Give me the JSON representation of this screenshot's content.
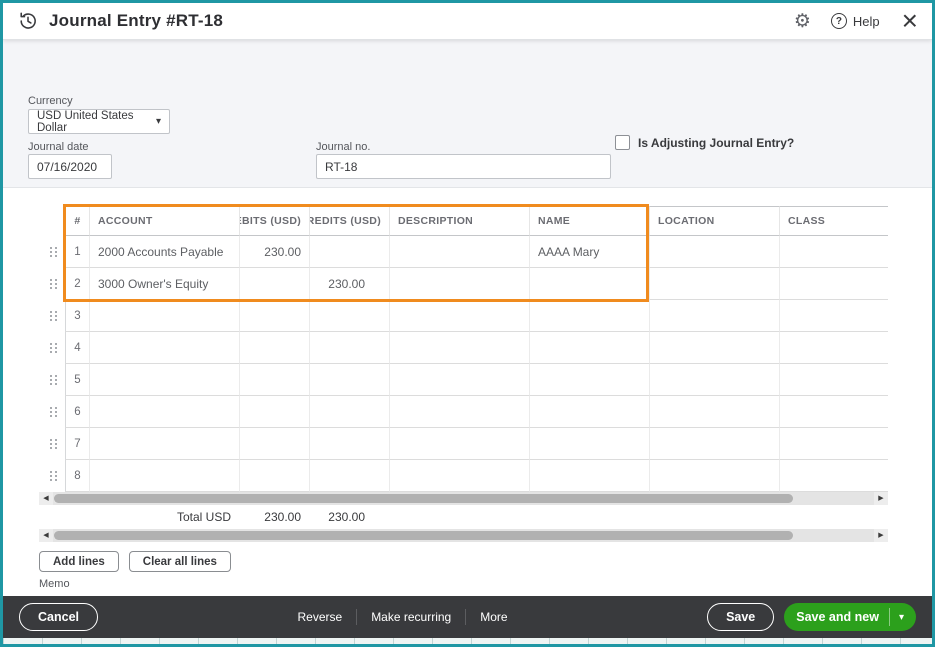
{
  "colors": {
    "teal": "#1f97a4",
    "orange": "#f08b1e",
    "green": "#2ca01c",
    "footer": "#393a3d"
  },
  "header": {
    "title": "Journal Entry #RT-18",
    "help_label": "Help"
  },
  "form": {
    "currency_label": "Currency",
    "currency_value": "USD United States Dollar",
    "journal_date_label": "Journal date",
    "journal_date_value": "07/16/2020",
    "journal_no_label": "Journal no.",
    "journal_no_value": "RT-18",
    "adjusting_label": "Is Adjusting Journal Entry?"
  },
  "table": {
    "columns": [
      "#",
      "ACCOUNT",
      "DEBITS (USD)",
      "CREDITS (USD)",
      "DESCRIPTION",
      "NAME",
      "LOCATION",
      "CLASS"
    ],
    "rows": [
      {
        "num": "1",
        "account": "2000 Accounts Payable",
        "debits": "230.00",
        "credits": "",
        "description": "",
        "name": "AAAA Mary",
        "location": "",
        "class": ""
      },
      {
        "num": "2",
        "account": "3000 Owner's Equity",
        "debits": "",
        "credits": "230.00",
        "description": "",
        "name": "",
        "location": "",
        "class": ""
      },
      {
        "num": "3",
        "account": "",
        "debits": "",
        "credits": "",
        "description": "",
        "name": "",
        "location": "",
        "class": ""
      },
      {
        "num": "4",
        "account": "",
        "debits": "",
        "credits": "",
        "description": "",
        "name": "",
        "location": "",
        "class": ""
      },
      {
        "num": "5",
        "account": "",
        "debits": "",
        "credits": "",
        "description": "",
        "name": "",
        "location": "",
        "class": ""
      },
      {
        "num": "6",
        "account": "",
        "debits": "",
        "credits": "",
        "description": "",
        "name": "",
        "location": "",
        "class": ""
      },
      {
        "num": "7",
        "account": "",
        "debits": "",
        "credits": "",
        "description": "",
        "name": "",
        "location": "",
        "class": ""
      },
      {
        "num": "8",
        "account": "",
        "debits": "",
        "credits": "",
        "description": "",
        "name": "",
        "location": "",
        "class": ""
      }
    ],
    "total_label": "Total USD",
    "total_debits": "230.00",
    "total_credits": "230.00"
  },
  "buttons": {
    "add_lines": "Add lines",
    "clear_all_lines": "Clear all lines"
  },
  "memo_label": "Memo",
  "footer": {
    "cancel": "Cancel",
    "reverse": "Reverse",
    "make_recurring": "Make recurring",
    "more": "More",
    "save": "Save",
    "save_and_new": "Save and new"
  }
}
